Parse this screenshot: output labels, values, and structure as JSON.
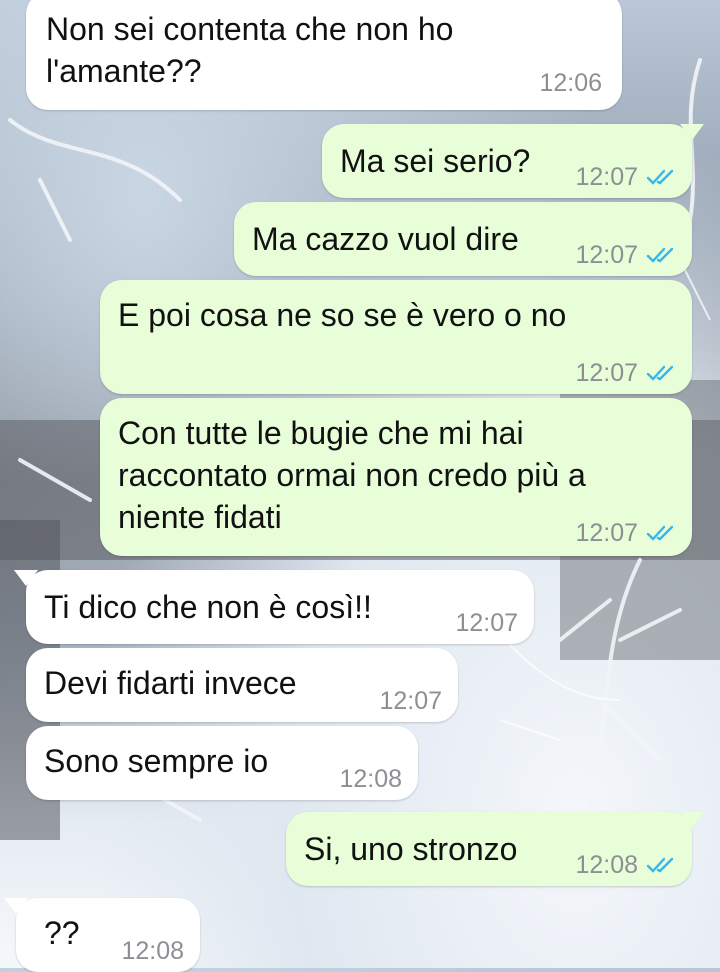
{
  "messages": [
    {
      "direction": "in",
      "text": "Non sei contenta che non ho\nl'amante??",
      "time": "12:06"
    },
    {
      "direction": "out",
      "text": "Ma sei serio?",
      "time": "12:07",
      "status": "read"
    },
    {
      "direction": "out",
      "text": "Ma cazzo vuol dire",
      "time": "12:07",
      "status": "read"
    },
    {
      "direction": "out",
      "text": "E poi cosa ne so se è vero o no",
      "time": "12:07",
      "status": "read"
    },
    {
      "direction": "out",
      "text": "Con tutte le bugie che mi hai\nraccontato ormai non credo più a\nniente fidati",
      "time": "12:07",
      "status": "read"
    },
    {
      "direction": "in",
      "text": "Ti dico che non è così!!",
      "time": "12:07"
    },
    {
      "direction": "in",
      "text": "Devi fidarti invece",
      "time": "12:07"
    },
    {
      "direction": "in",
      "text": "Sono sempre io",
      "time": "12:08"
    },
    {
      "direction": "out",
      "text": "Si, uno stronzo",
      "time": "12:08",
      "status": "read"
    },
    {
      "direction": "in",
      "text": "??",
      "time": "12:08"
    }
  ],
  "colors": {
    "incoming_bubble": "#ffffff",
    "outgoing_bubble": "#e7fed9",
    "timestamp": "#8c8f93",
    "read_ticks": "#34b7f1"
  },
  "icons": {
    "read_receipt": "double-check-icon",
    "wallpaper": "snowy-branches-wallpaper"
  }
}
